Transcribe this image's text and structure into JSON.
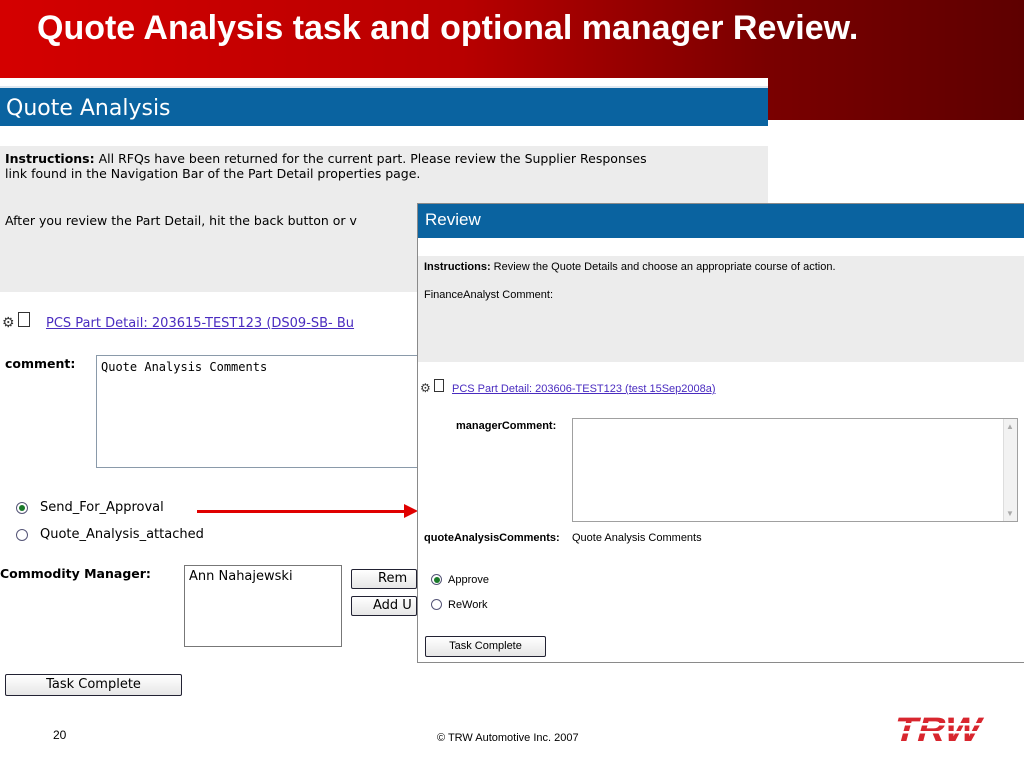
{
  "slide": {
    "title": "Quote Analysis task and optional manager Review.",
    "page_number": "20",
    "copyright": "© TRW Automotive Inc. 2007",
    "logo_text": "TRW",
    "colors": {
      "banner_red": "#c00000",
      "header_blue": "#0a63a0",
      "arrow_red": "#e00000",
      "logo_red": "#d8262e"
    }
  },
  "quote_analysis": {
    "header": "Quote Analysis",
    "instructions_label": "Instructions:",
    "instructions_line1": " All RFQs have been returned for the current part. Please review the Supplier Responses",
    "instructions_line2": "link found in the Navigation Bar of the Part Detail properties page.",
    "instructions_line3": "After you review the Part Detail, hit the back button or v",
    "part_link": " PCS Part Detail: 203615-TEST123 (DS09-SB- Bu",
    "comment_label": "comment:",
    "comment_value": "Quote Analysis Comments",
    "radios": [
      {
        "label": "Send_For_Approval",
        "selected": true
      },
      {
        "label": "Quote_Analysis_attached",
        "selected": false
      }
    ],
    "commodity_manager_label": "Commodity Manager:",
    "commodity_manager_value": "Ann Nahajewski",
    "remove_button": "Rem",
    "add_button": "Add U",
    "task_complete_button": "Task Complete"
  },
  "review": {
    "header": "Review",
    "instructions_label": "Instructions:",
    "instructions_text": " Review the Quote Details and choose an appropriate course of action.",
    "finance_comment_label": "FinanceAnalyst Comment:",
    "part_link": " PCS Part Detail: 203606-TEST123 (test 15Sep2008a)",
    "manager_comment_label": "managerComment:",
    "manager_comment_value": "",
    "quote_analysis_comments_label": "quoteAnalysisComments:",
    "quote_analysis_comments_value": "Quote Analysis Comments",
    "radios": [
      {
        "label": "Approve",
        "selected": true
      },
      {
        "label": "ReWork",
        "selected": false
      }
    ],
    "task_complete_button": "Task Complete"
  }
}
